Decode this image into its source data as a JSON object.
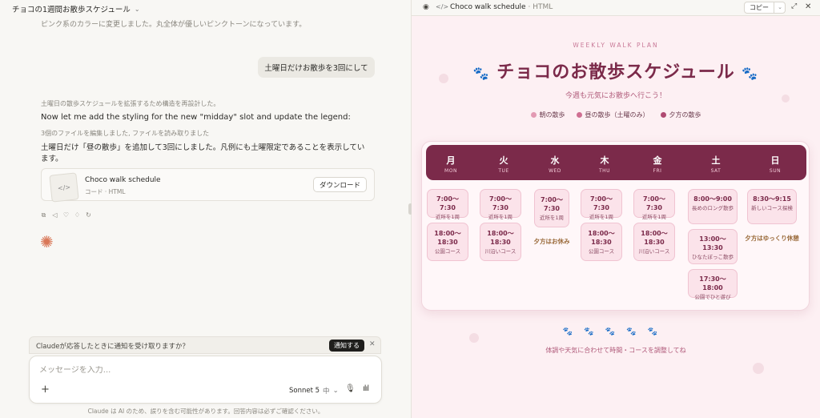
{
  "chat": {
    "title": "チョコの1週間お散歩スケジュール",
    "prev_text": "ピンク系のカラーに変更しました。丸全体が優しいピンクトーンになっています。",
    "user_message": "土曜日だけお散歩を3回にして",
    "thought_1": "土曜日の散歩スケジュールを拡張するため構造を再設計した。",
    "english_line": "Now let me add the styling for the new \"midday\" slot and update the legend:",
    "thought_2": "3個のファイルを編集しました, ファイルを読み取りました",
    "answer": "土曜日だけ「昼の散歩」を追加して3回にしました。凡例にも土曜限定であることを表示しています。",
    "artifact_name": "Choco walk schedule",
    "artifact_type": "コード · HTML",
    "download_label": "ダウンロード",
    "notify_text": "Claudeが応答したときに通知を受け取りますか？",
    "notify_button": "通知する",
    "input_placeholder": "メッセージを入力...",
    "model": "Sonnet 5",
    "model_size": "中",
    "disclaimer": "Claude は AI のため、誤りを含む可能性があります。回答内容は必ずご確認ください。"
  },
  "artifact_header": {
    "title": "Choco walk schedule",
    "type": "· HTML",
    "copy_label": "コピー"
  },
  "schedule": {
    "eyebrow": "WEEKLY WALK PLAN",
    "title": "チョコのお散歩スケジュール",
    "subtitle": "今週も元気にお散歩へ行こう！",
    "legend": [
      {
        "label": "朝の散歩",
        "color": "#e39ab3"
      },
      {
        "label": "昼の散歩（土曜のみ）",
        "color": "#cf6f92"
      },
      {
        "label": "夕方の散歩",
        "color": "#b04a72"
      }
    ],
    "days": [
      {
        "jp": "月",
        "en": "MON",
        "slots": [
          {
            "time": "7:00〜7:30",
            "place": "近所を1周"
          },
          {
            "time": "18:00〜18:30",
            "place": "公園コース"
          }
        ],
        "rest": ""
      },
      {
        "jp": "火",
        "en": "TUE",
        "slots": [
          {
            "time": "7:00〜7:30",
            "place": "近所を1周"
          },
          {
            "time": "18:00〜18:30",
            "place": "川沿いコース"
          }
        ],
        "rest": ""
      },
      {
        "jp": "水",
        "en": "WED",
        "slots": [
          {
            "time": "7:00〜7:30",
            "place": "近所を1周"
          }
        ],
        "rest": "夕方はお休み"
      },
      {
        "jp": "木",
        "en": "THU",
        "slots": [
          {
            "time": "7:00〜7:30",
            "place": "近所を1周"
          },
          {
            "time": "18:00〜18:30",
            "place": "公園コース"
          }
        ],
        "rest": ""
      },
      {
        "jp": "金",
        "en": "FRI",
        "slots": [
          {
            "time": "7:00〜7:30",
            "place": "近所を1周"
          },
          {
            "time": "18:00〜18:30",
            "place": "川沿いコース"
          }
        ],
        "rest": ""
      },
      {
        "jp": "土",
        "en": "SAT",
        "slots": [
          {
            "time": "8:00〜9:00",
            "place": "長めのロング散歩"
          },
          {
            "time": "13:00〜13:30",
            "place": "ひなたぼっこ散歩"
          },
          {
            "time": "17:30〜18:00",
            "place": "公園でひと遊び"
          }
        ],
        "rest": ""
      },
      {
        "jp": "日",
        "en": "SUN",
        "slots": [
          {
            "time": "8:30〜9:15",
            "place": "新しいコース探検"
          }
        ],
        "rest": "夕方はゆっくり休憩"
      }
    ],
    "footer_paws": "🐾🐾🐾🐾🐾",
    "footer_note": "体調や天気に合わせて時間・コースを調整してね"
  }
}
